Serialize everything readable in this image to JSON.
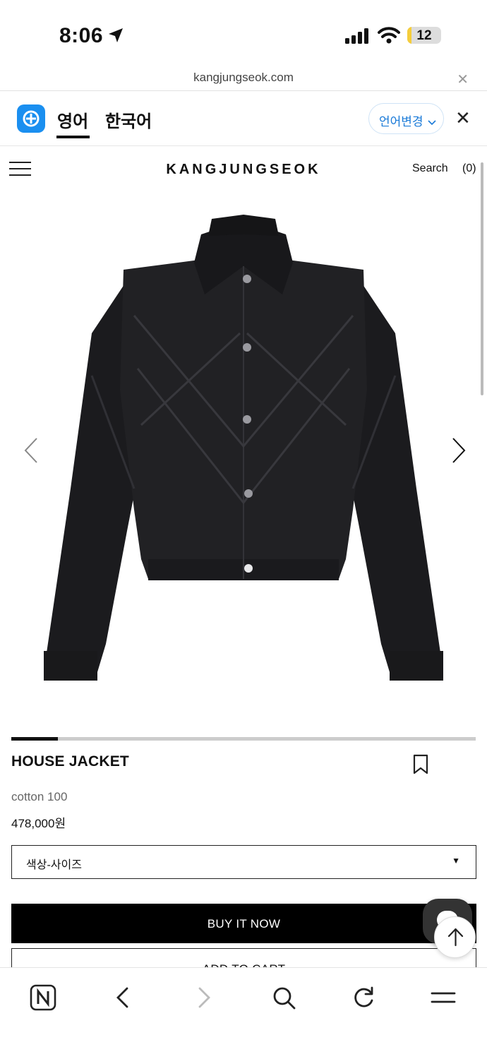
{
  "status_bar": {
    "time": "8:06",
    "battery": "12",
    "battery_level": 0.12
  },
  "url_bar": {
    "url": "kangjungseok.com"
  },
  "translate_bar": {
    "tab_english": "영어",
    "tab_korean": "한국어",
    "change_language": "언어변경",
    "accent_color": "#1a8ff0"
  },
  "header": {
    "logo": "KANGJUNGSEOK",
    "search": "Search",
    "cart": "(0)"
  },
  "gallery": {
    "progress": 0.1
  },
  "product": {
    "title": "HOUSE JACKET",
    "material": "cotton 100",
    "price": "478,000원",
    "option_placeholder": "색상-사이즈",
    "buy_now": "BUY IT NOW",
    "add_to_cart": "ADD TO CART"
  },
  "icons": {
    "papago": "papago-logo-icon",
    "close": "close-icon",
    "menu": "hamburger-menu-icon",
    "prev": "chevron-left-icon",
    "next": "chevron-right-icon",
    "bookmark": "bookmark-icon",
    "chat": "chat-icon",
    "scroll_top": "arrow-up-icon",
    "toolbar": [
      "naver-home-icon",
      "back-icon",
      "forward-icon",
      "search-icon",
      "refresh-icon",
      "menu-icon"
    ]
  }
}
